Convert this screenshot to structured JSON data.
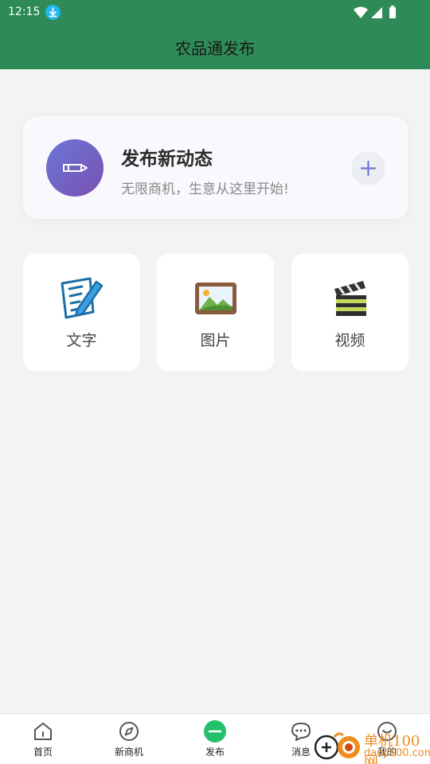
{
  "status_bar": {
    "time": "12:15"
  },
  "app_bar": {
    "title": "农品通发布"
  },
  "hero": {
    "title": "发布新动态",
    "subtitle": "无限商机，生意从这里开始!"
  },
  "options": [
    {
      "label": "文字",
      "icon": "memo-pencil-icon"
    },
    {
      "label": "图片",
      "icon": "framed-picture-icon"
    },
    {
      "label": "视频",
      "icon": "clapper-board-icon"
    }
  ],
  "tabs": [
    {
      "label": "首页",
      "icon": "home-icon"
    },
    {
      "label": "新商机",
      "icon": "compass-icon"
    },
    {
      "label": "发布",
      "icon": "publish-icon",
      "active": true
    },
    {
      "label": "消息",
      "icon": "chat-icon"
    },
    {
      "label": "我的",
      "icon": "profile-icon"
    }
  ],
  "watermark": {
    "site": "单机100网",
    "domain": "danji100.com"
  },
  "colors": {
    "primary": "#2e8b57",
    "active_tab": "#23c06a",
    "hero_gradient_start": "#6a77d8",
    "hero_gradient_end": "#7a4fb0"
  }
}
